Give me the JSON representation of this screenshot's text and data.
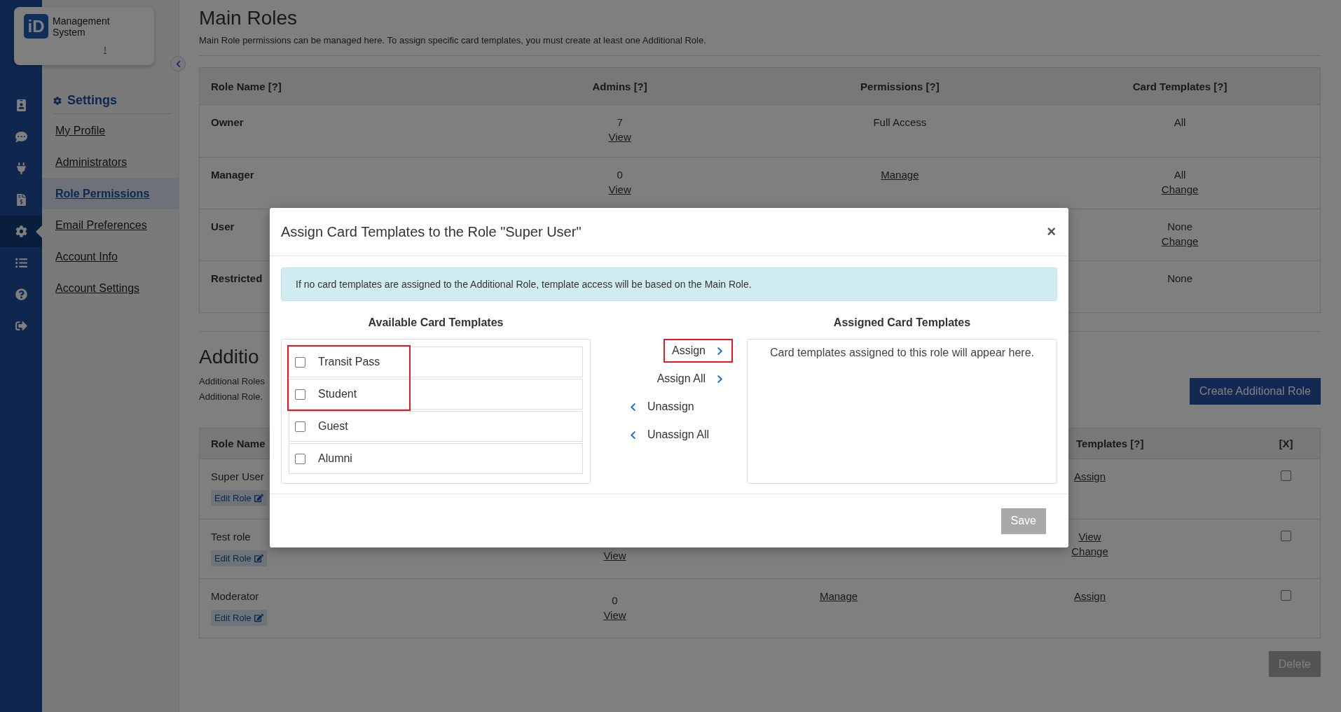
{
  "logo": {
    "mark": "iD",
    "name": "Management System",
    "note": "!"
  },
  "rail": [
    {
      "selected": false
    },
    {
      "selected": false
    },
    {
      "selected": false
    },
    {
      "selected": false
    },
    {
      "selected": true
    },
    {
      "selected": false
    },
    {
      "selected": false
    },
    {
      "selected": false
    }
  ],
  "settings_nav": {
    "title": "Settings",
    "items": [
      {
        "label": "My Profile",
        "selected": false
      },
      {
        "label": "Administrators",
        "selected": false
      },
      {
        "label": "Role Permissions",
        "selected": true
      },
      {
        "label": "Email Preferences",
        "selected": false
      },
      {
        "label": "Account Info",
        "selected": false
      },
      {
        "label": "Account Settings",
        "selected": false
      }
    ]
  },
  "main_roles": {
    "title": "Main Roles",
    "description": "Main Role permissions can be managed here. To assign specific card templates, you must create at least one Additional Role.",
    "columns": [
      "Role Name [?]",
      "Admins [?]",
      "Permissions [?]",
      "Card Templates [?]"
    ],
    "rows": [
      {
        "name": "Owner",
        "admins": [
          {
            "text": "7",
            "link": false
          },
          {
            "text": "View",
            "link": true
          }
        ],
        "permissions": [
          {
            "text": "Full Access",
            "link": false
          }
        ],
        "card_templates": [
          {
            "text": "All",
            "link": false
          }
        ]
      },
      {
        "name": "Manager",
        "admins": [
          {
            "text": "0",
            "link": false
          },
          {
            "text": "View",
            "link": true
          }
        ],
        "permissions": [
          {
            "text": "Manage",
            "link": true
          }
        ],
        "card_templates": [
          {
            "text": "All",
            "link": false
          },
          {
            "text": "Change",
            "link": true
          }
        ]
      },
      {
        "name": "User",
        "admins": [],
        "permissions": [],
        "card_templates": [
          {
            "text": "None",
            "link": false
          },
          {
            "text": "Change",
            "link": true
          }
        ]
      },
      {
        "name": "Restricted",
        "admins": [],
        "permissions": [],
        "card_templates": [
          {
            "text": "None",
            "link": false
          }
        ]
      }
    ]
  },
  "additional_roles": {
    "title": "Additio",
    "description": [
      "Additional Roles",
      "Additional Role."
    ],
    "create_button": "Create Additional Role",
    "columns": [
      "Role Name",
      "",
      "",
      "Templates [?]",
      "[X]"
    ],
    "rows": [
      {
        "name": "Super User",
        "edit": "Edit Role",
        "admins": [],
        "permissions": [],
        "card_templates": [
          {
            "text": "Assign",
            "link": true
          }
        ],
        "checked": false
      },
      {
        "name": "Test role",
        "edit": "Edit Role",
        "admins": [
          {
            "text": "View",
            "link": true
          }
        ],
        "permissions": [],
        "card_templates": [
          {
            "text": "View",
            "link": true
          },
          {
            "text": "Change",
            "link": true
          }
        ],
        "checked": false
      },
      {
        "name": "Moderator",
        "edit": "Edit Role",
        "admins": [
          {
            "text": "0",
            "link": false
          },
          {
            "text": "View",
            "link": true
          }
        ],
        "permissions": [
          {
            "text": "Manage",
            "link": true
          }
        ],
        "card_templates": [
          {
            "text": "Assign",
            "link": true
          }
        ],
        "checked": false
      }
    ],
    "delete_button": {
      "label": "Delete",
      "disabled": true
    }
  },
  "modal": {
    "title": "Assign Card Templates to the Role \"Super User\"",
    "close": "×",
    "alert": "If no card templates are assigned to the Additional Role, template access will be based on the Main Role.",
    "available_title": "Available Card Templates",
    "assigned_title": "Assigned Card Templates",
    "available": [
      {
        "label": "Transit Pass",
        "checked": false,
        "highlighted": true
      },
      {
        "label": "Student",
        "checked": false,
        "highlighted": true
      },
      {
        "label": "Guest",
        "checked": false,
        "highlighted": false
      },
      {
        "label": "Alumni",
        "checked": false,
        "highlighted": false
      }
    ],
    "actions": [
      {
        "label": "Assign",
        "kind": "forward",
        "highlighted": true
      },
      {
        "label": "Assign All",
        "kind": "forward",
        "highlighted": false
      },
      {
        "label": "Unassign",
        "kind": "back",
        "highlighted": false
      },
      {
        "label": "Unassign All",
        "kind": "back",
        "highlighted": false
      }
    ],
    "assigned_placeholder": "Card templates assigned to this role will appear here.",
    "save": {
      "label": "Save",
      "disabled": true
    }
  }
}
